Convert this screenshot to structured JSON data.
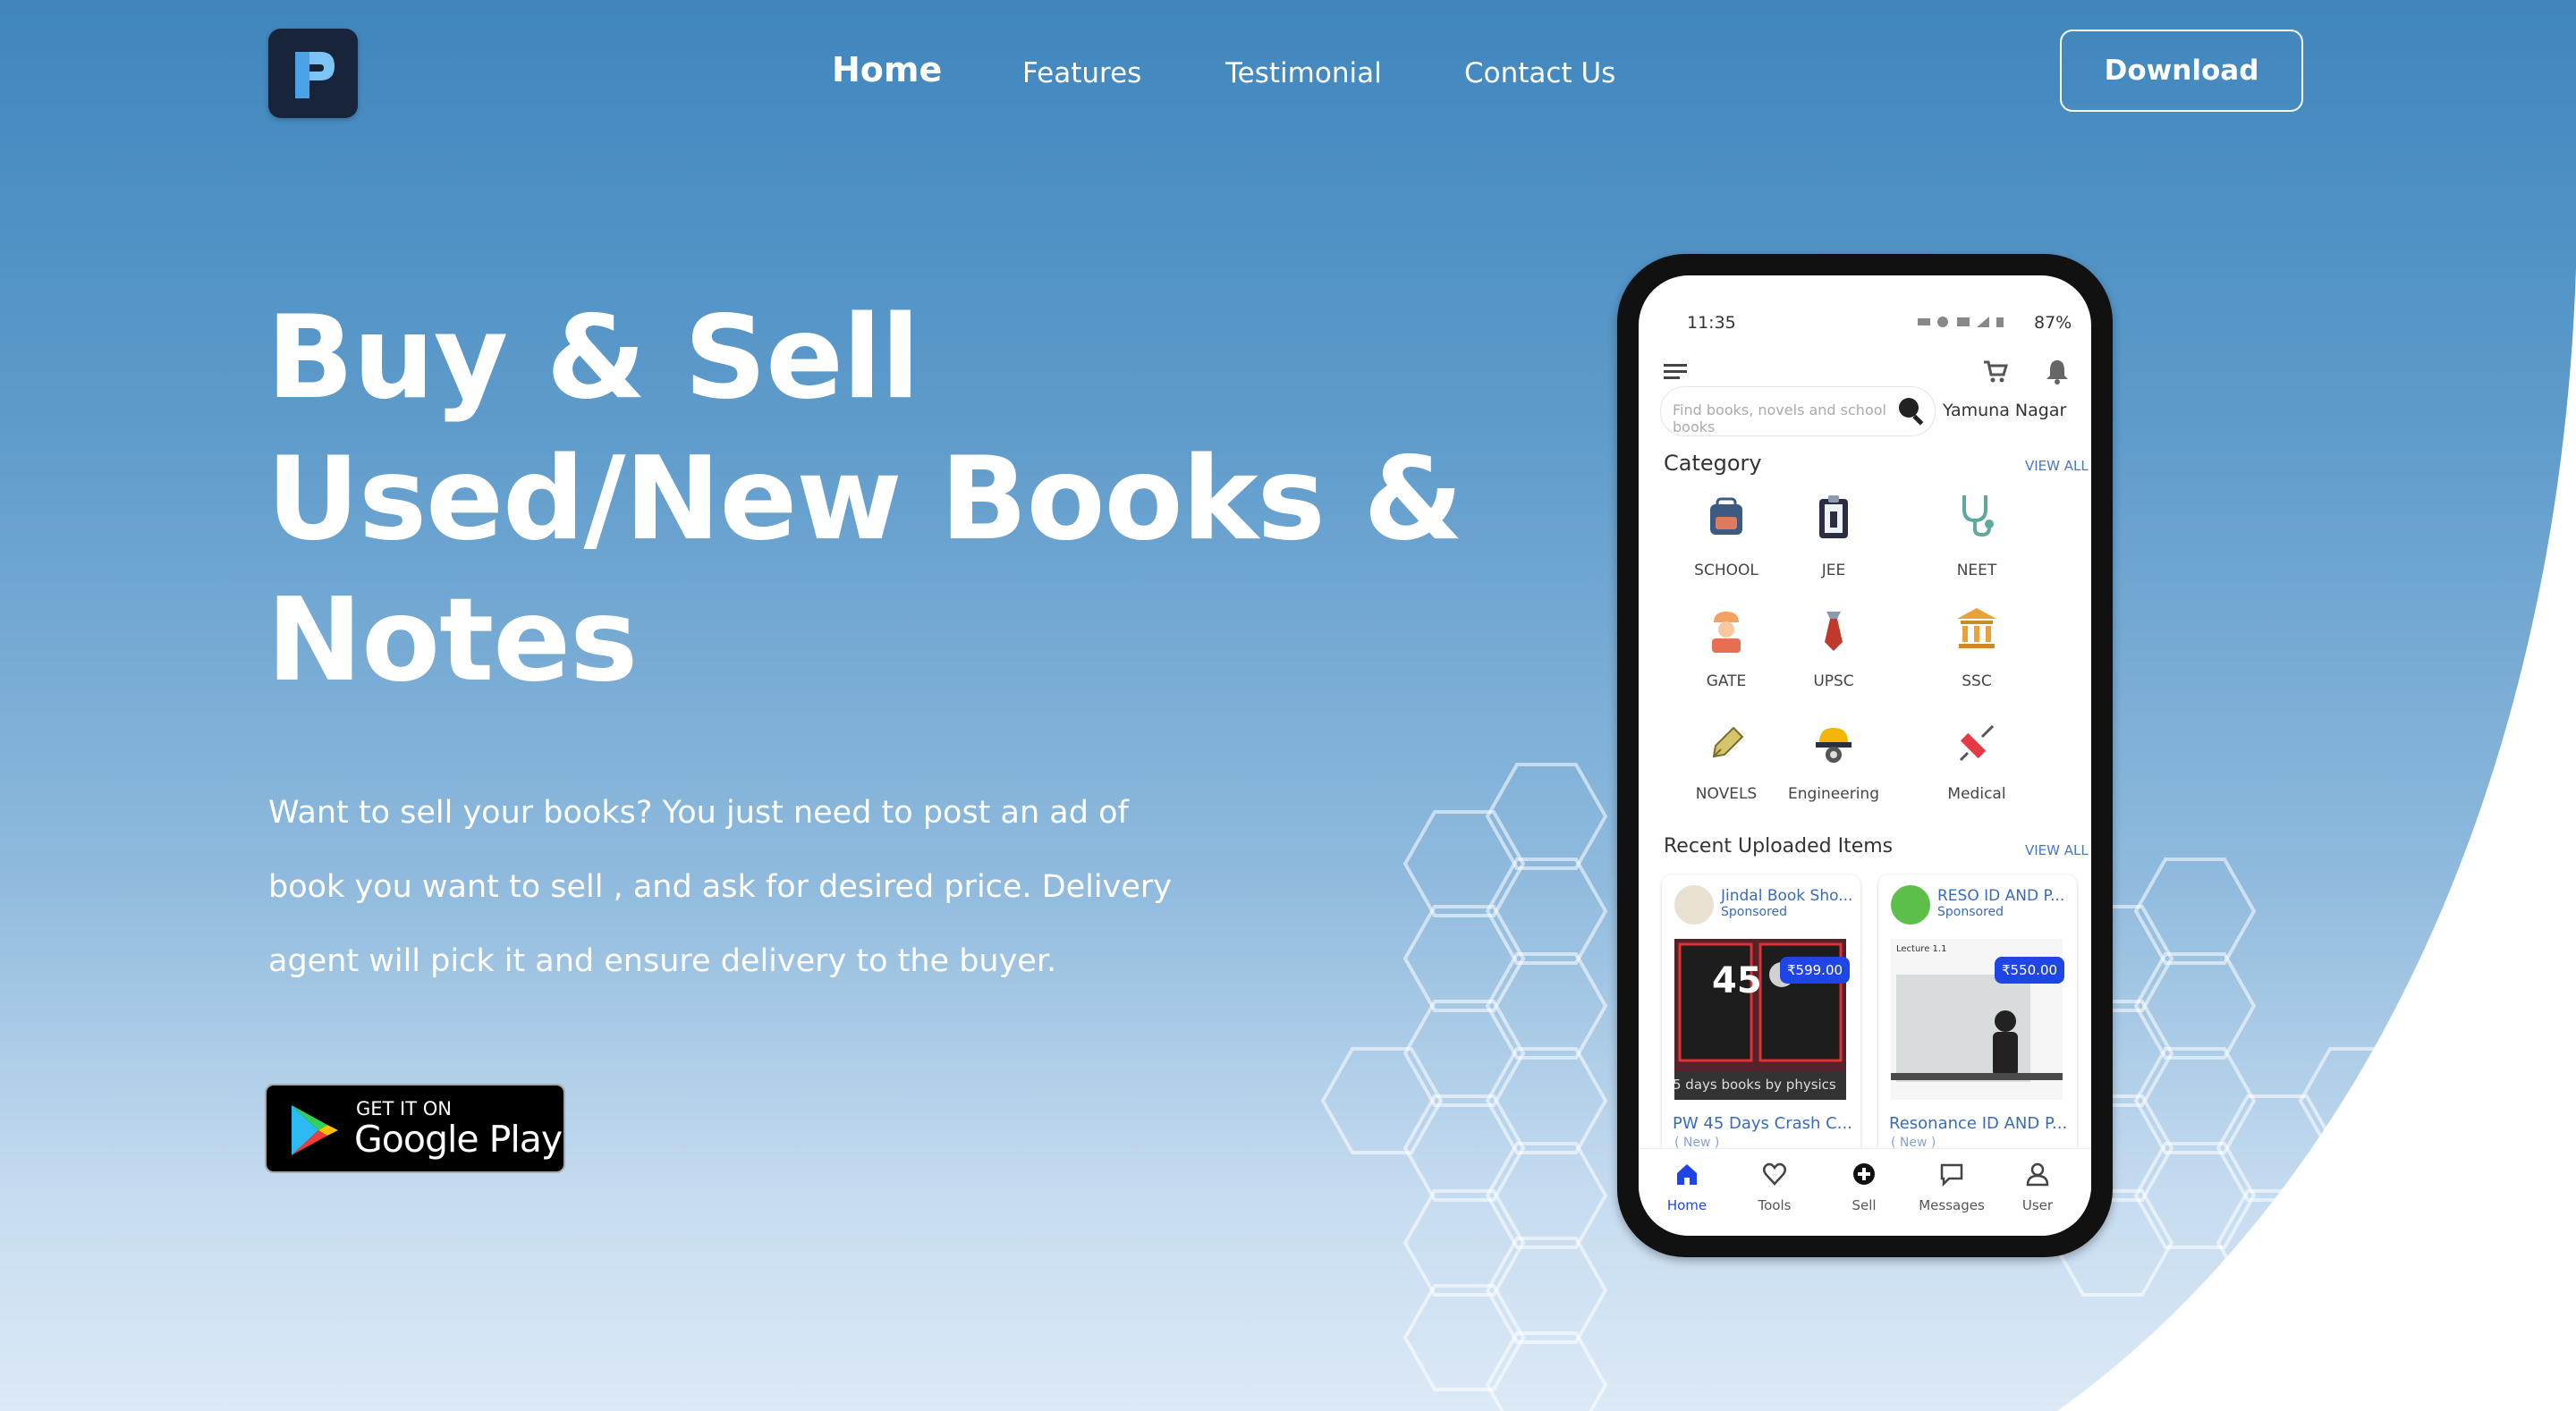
{
  "nav": {
    "logo_letter": "P",
    "links": [
      {
        "label": "Home",
        "active": true
      },
      {
        "label": "Features"
      },
      {
        "label": "Testimonial"
      },
      {
        "label": "Contact Us"
      }
    ],
    "download_label": "Download"
  },
  "hero": {
    "title_lines": [
      "Buy & Sell",
      "Used/New Books &",
      "Notes"
    ],
    "description": "Want to sell your books? You just need to post an ad of book you want to sell , and ask for desired price. Delivery agent will pick it and ensure delivery to the buyer.",
    "store_badge": {
      "small": "GET IT ON",
      "big": "Google Play"
    }
  },
  "phone": {
    "status": {
      "time": "11:35",
      "battery": "87%"
    },
    "search_placeholder": "Find books, novels and school books",
    "location": "Yamuna Nagar",
    "category": {
      "title": "Category",
      "view_all": "VIEW ALL",
      "items": [
        "SCHOOL",
        "JEE",
        "NEET",
        "GATE",
        "UPSC",
        "SSC",
        "NOVELS",
        "Engineering",
        "Medical"
      ]
    },
    "recent": {
      "title": "Recent Uploaded Items",
      "view_all": "VIEW ALL",
      "items": [
        {
          "seller": "Jindal Book Sho...",
          "sponsored": "Sponsored",
          "price": "₹599.00",
          "image_caption": "5 days books by physics",
          "image_text": "45",
          "title": "PW 45 Days Crash C...",
          "condition": "( New )"
        },
        {
          "seller": "RESO ID AND P...",
          "sponsored": "Sponsored",
          "price": "₹550.00",
          "image_caption": "Lecture 1.1",
          "title": "Resonance ID AND P...",
          "condition": "( New )"
        }
      ]
    },
    "bottom_nav": [
      "Home",
      "Tools",
      "Sell",
      "Messages",
      "User"
    ]
  },
  "colors": {
    "accent": "#2045e6",
    "link": "#3b6bb5",
    "logo_bg": "#18243a",
    "bg_top": "#3f86bd",
    "bg_bottom": "#dce9f6"
  }
}
